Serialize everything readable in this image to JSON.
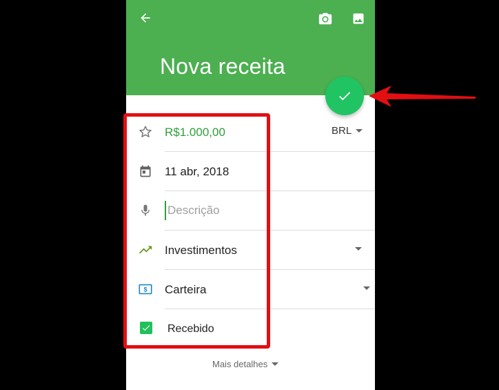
{
  "header": {
    "title": "Nova receita",
    "color": "#4caf50",
    "icons": [
      "arrow-back-icon",
      "camera-icon",
      "image-icon"
    ]
  },
  "fab": {
    "icon": "check-icon",
    "color": "#20c463"
  },
  "form": {
    "amount": "R$1.000,00",
    "currency": "BRL",
    "date": "11 abr, 2018",
    "description_placeholder": "Descrição",
    "category": "Investimentos",
    "account": "Carteira",
    "received_label": "Recebido",
    "received_checked": true
  },
  "more_details": "Mais detalhes",
  "annotation": {
    "highlight_color": "#e30e12"
  }
}
